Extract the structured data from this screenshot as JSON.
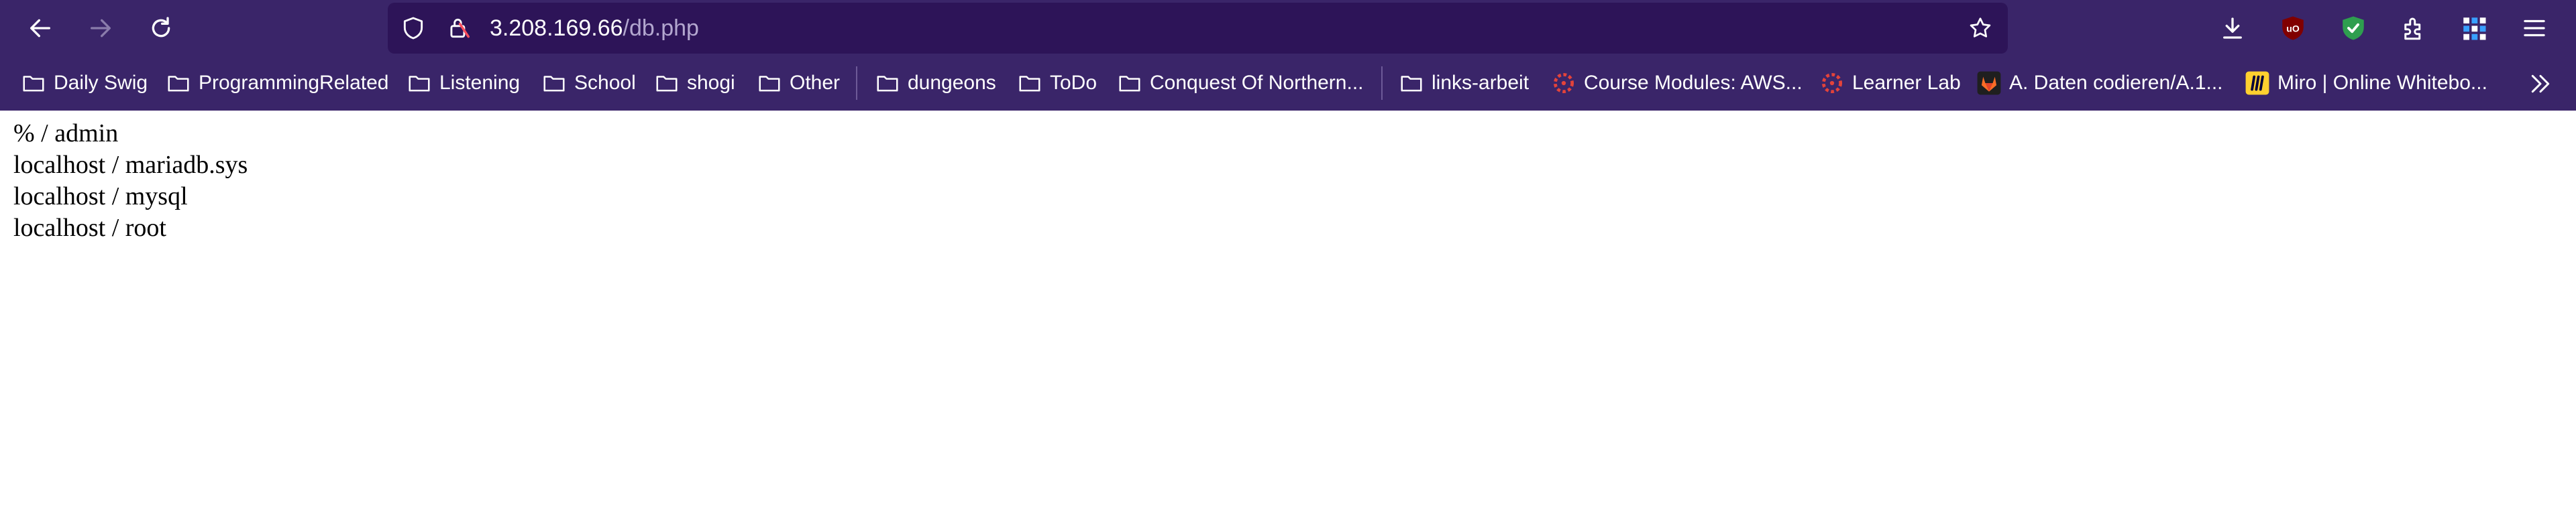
{
  "browser": {
    "address_bar": {
      "host": "3.208.169.66",
      "path": "/db.php"
    },
    "bookmarks": [
      {
        "label": "Daily Swig",
        "icon": "folder-icon"
      },
      {
        "label": "ProgrammingRelated",
        "icon": "folder-icon"
      },
      {
        "label": "Listening",
        "icon": "folder-icon"
      },
      {
        "label": "School",
        "icon": "folder-icon"
      },
      {
        "label": "shogi",
        "icon": "folder-icon"
      },
      {
        "label": "Other",
        "icon": "folder-icon"
      },
      {
        "label": "dungeons",
        "icon": "folder-icon"
      },
      {
        "label": "ToDo",
        "icon": "folder-icon"
      },
      {
        "label": "Conquest Of Northern...",
        "icon": "folder-icon"
      },
      {
        "label": "links-arbeit",
        "icon": "folder-icon"
      },
      {
        "label": "Course Modules: AWS...",
        "icon": "canvas-icon"
      },
      {
        "label": "Learner Lab",
        "icon": "canvas-icon"
      },
      {
        "label": "A. Daten codieren/A.1...",
        "icon": "gitlab-icon"
      },
      {
        "label": "Miro | Online Whitebo...",
        "icon": "miro-icon"
      }
    ],
    "colors": {
      "toolbar_bg": "#3a2569",
      "urlbar_bg": "#2d1458",
      "ublock_red": "#800000",
      "shield_green": "#2e9e4f"
    }
  },
  "page": {
    "lines": [
      "% / admin",
      "localhost / mariadb.sys",
      "localhost / mysql",
      "localhost / root"
    ]
  }
}
